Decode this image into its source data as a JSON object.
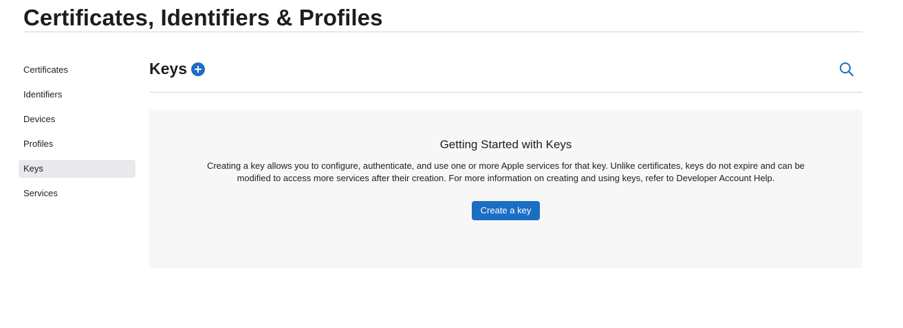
{
  "page": {
    "title": "Certificates, Identifiers & Profiles"
  },
  "sidebar": {
    "items": [
      {
        "label": "Certificates"
      },
      {
        "label": "Identifiers"
      },
      {
        "label": "Devices"
      },
      {
        "label": "Profiles"
      },
      {
        "label": "Keys",
        "active": true
      },
      {
        "label": "Services"
      }
    ]
  },
  "main": {
    "section_title": "Keys",
    "add_icon": "plus-circle-icon",
    "search_icon": "search-icon",
    "empty_state": {
      "title": "Getting Started with Keys",
      "description": "Creating a key allows you to configure, authenticate, and use one or more Apple services for that key. Unlike certificates, keys do not expire and can be modified to access more services after their creation. For more information on creating and using keys, refer to Developer Account Help.",
      "button_label": "Create a key"
    }
  },
  "colors": {
    "accent": "#1a6ec4",
    "panel_bg": "#f7f7f7",
    "active_item_bg": "#e8e8ed",
    "divider": "#d2d2d7"
  }
}
